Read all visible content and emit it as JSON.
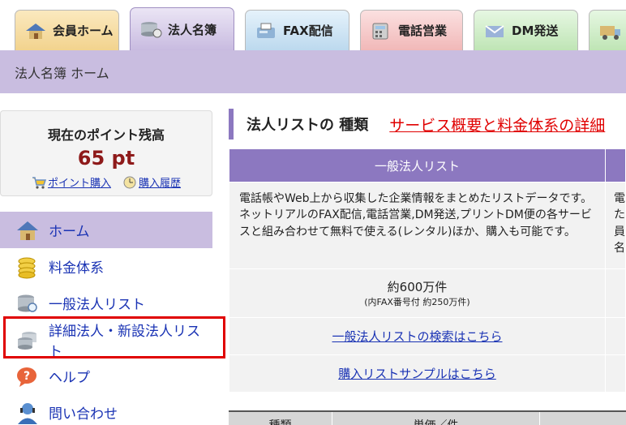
{
  "tabs": [
    {
      "label": "会員ホーム",
      "icon": "house-icon"
    },
    {
      "label": "法人名簿",
      "icon": "database-icon",
      "active": true
    },
    {
      "label": "FAX配信",
      "icon": "fax-icon"
    },
    {
      "label": "電話営業",
      "icon": "phone-icon"
    },
    {
      "label": "DM発送",
      "icon": "envelope-icon"
    },
    {
      "label": "",
      "icon": "truck-icon"
    }
  ],
  "breadcrumb": "法人名簿 ホーム",
  "points": {
    "title": "現在のポイント残高",
    "value": "65 pt",
    "buy_link": "ポイント購入",
    "history_link": "購入履歴"
  },
  "side_nav": [
    {
      "label": "ホーム",
      "icon": "house-icon",
      "active": true
    },
    {
      "label": "料金体系",
      "icon": "coins-icon"
    },
    {
      "label": "一般法人リスト",
      "icon": "database-search-icon"
    },
    {
      "label": "詳細法人・新設法人リスト",
      "icon": "database-stack-icon"
    },
    {
      "label": "ヘルプ",
      "icon": "help-icon"
    },
    {
      "label": "問い合わせ",
      "icon": "support-person-icon"
    }
  ],
  "main": {
    "section_title": "法人リストの 種類",
    "service_link": "サービス概要と料金体系の詳細",
    "table": {
      "header": "一般法人リスト",
      "description": "電話帳やWeb上から収集した企業情報をまとめたリストデータです。ネットリアルのFAX配信,電話営業,DM発送,プリントDM便の各サービスと組み合わせて無料で使える(レンタル)ほか、購入も可能です。",
      "count_main": "約600万件",
      "count_sub": "(内FAX番号付 約250万件)",
      "search_link": "一般法人リストの検索はこちら",
      "sample_link": "購入リストサンプルはこちら",
      "next_col_text": "電た員名"
    },
    "bottom_headers": [
      "種類",
      "単価／件"
    ]
  },
  "colors": {
    "accent_purple": "#8c78c0",
    "breadcrumb_bg": "#c9bde0",
    "link_blue": "#1a33b4",
    "red": "#e00000",
    "points_red": "#8e1a1a"
  }
}
